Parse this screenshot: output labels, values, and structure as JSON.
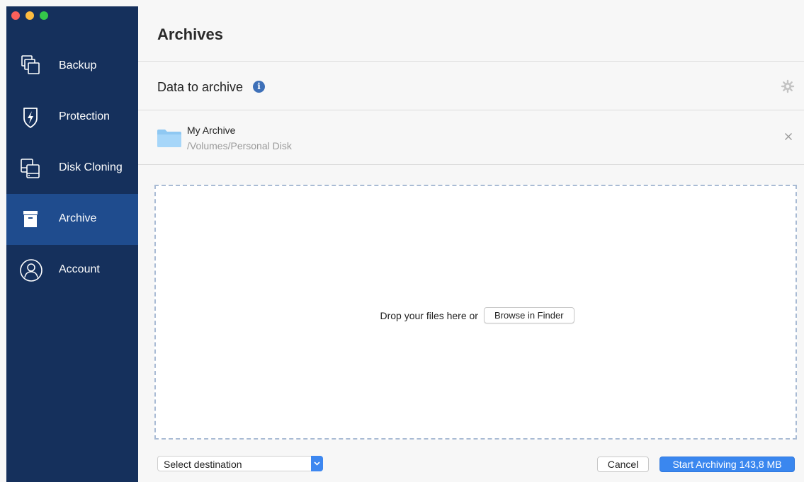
{
  "sidebar": {
    "items": [
      {
        "label": "Backup",
        "icon": "backup-icon"
      },
      {
        "label": "Protection",
        "icon": "protection-shield-icon"
      },
      {
        "label": "Disk Cloning",
        "icon": "disk-cloning-icon"
      },
      {
        "label": "Archive",
        "icon": "archive-box-icon",
        "selected": true
      },
      {
        "label": "Account",
        "icon": "account-user-icon"
      }
    ]
  },
  "main": {
    "title": "Archives",
    "data_header": {
      "label": "Data to archive",
      "info_icon": "info-icon",
      "settings_icon": "gear-icon"
    },
    "archive": {
      "name": "My Archive",
      "path": "/Volumes/Personal Disk",
      "icon": "folder-icon"
    },
    "drop_zone": {
      "text": "Drop your files here or",
      "browse_label": "Browse in Finder"
    },
    "footer": {
      "destination_label": "Select destination",
      "cancel_label": "Cancel",
      "start_label": "Start Archiving 143,8 MB"
    }
  },
  "colors": {
    "sidebar_bg": "#15305c",
    "sidebar_selected": "#1f4c8e",
    "accent": "#3a87ef",
    "drop_border": "#a9bbd4"
  }
}
